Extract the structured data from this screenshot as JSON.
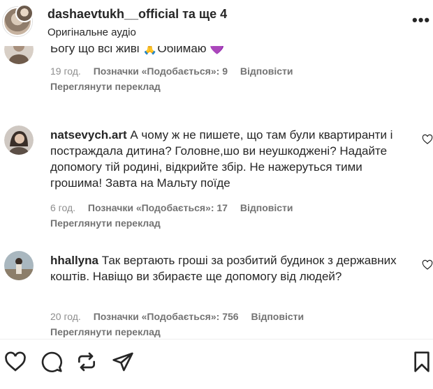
{
  "header": {
    "username": "dashaevtukh__official",
    "others": " та ще 4",
    "subtitle": "Оригінальне аудіо",
    "more_label": "•••"
  },
  "comments": [
    {
      "text": "Богу що всі живі 🙏Обіймаю 💜",
      "time": "19 год.",
      "likes": "Позначки «Подобається»: 9",
      "reply": "Відповісти",
      "translate": "Переглянути переклад"
    },
    {
      "user": "natsevych.art",
      "text": " А чому ж не пишете, що там були квартиранти і постраждала дитина? Головне,шо ви неушкоджені? Надайте допомогу тій родині, відкрийте збір. Не нажеруться тими грошима! Завта на Мальту поїде",
      "time": "6 год.",
      "likes": "Позначки «Подобається»: 17",
      "reply": "Відповісти",
      "translate": "Переглянути переклад"
    },
    {
      "user": "hhallyna",
      "text": " Так вертають гроші за розбитий будинок з державних коштів. Навіщо ви збираєте ще допомогу від людей?",
      "time": "20 год.",
      "likes": "Позначки «Подобається»: 756",
      "reply": "Відповісти",
      "translate": "Переглянути переклад"
    }
  ],
  "actions": {
    "icons": [
      "heart-icon",
      "comment-icon",
      "repost-icon",
      "share-icon",
      "bookmark-icon"
    ]
  },
  "colors": {
    "text": "#262626",
    "muted": "#8e8e8e",
    "bold_muted": "#737373"
  }
}
